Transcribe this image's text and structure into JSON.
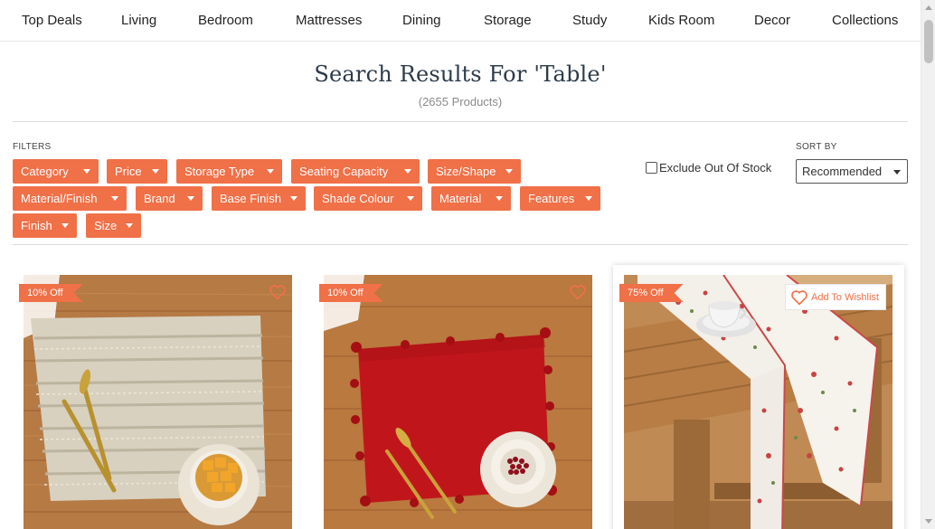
{
  "nav": {
    "items": [
      {
        "label": "Top Deals"
      },
      {
        "label": "Living"
      },
      {
        "label": "Bedroom"
      },
      {
        "label": "Mattresses"
      },
      {
        "label": "Dining"
      },
      {
        "label": "Storage"
      },
      {
        "label": "Study"
      },
      {
        "label": "Kids Room"
      },
      {
        "label": "Decor"
      },
      {
        "label": "Collections"
      }
    ]
  },
  "search": {
    "title": "Search Results For 'Table'",
    "count": "(2655 Products)"
  },
  "filters": {
    "label": "FILTERS",
    "chips": [
      {
        "label": "Category"
      },
      {
        "label": "Price"
      },
      {
        "label": "Storage Type"
      },
      {
        "label": "Seating Capacity"
      },
      {
        "label": "Size/Shape"
      },
      {
        "label": "Material/Finish"
      },
      {
        "label": "Brand"
      },
      {
        "label": "Base Finish"
      },
      {
        "label": "Shade Colour"
      },
      {
        "label": "Material"
      },
      {
        "label": "Features"
      },
      {
        "label": "Finish"
      },
      {
        "label": "Size"
      }
    ],
    "exclude_out_of_stock": {
      "label": "Exclude Out Of Stock",
      "checked": false
    }
  },
  "sort": {
    "label": "SORT BY",
    "selected": "Recommended"
  },
  "products": [
    {
      "discount": "10% Off",
      "wishlist_label": "",
      "image": "woven beige placemat with gold cutlery and bowl of mango"
    },
    {
      "discount": "10% Off",
      "wishlist_label": "",
      "image": "red placemat with pom-poms, gold cutlery and bowl of berries"
    },
    {
      "discount": "75% Off",
      "wishlist_label": "Add To Wishlist",
      "image": "floral table runner on rustic wooden table with cup and saucer"
    }
  ],
  "colors": {
    "accent": "#f07048",
    "title": "#2d3b4a",
    "wood": "#b9793f",
    "red_mat": "#c0161b"
  },
  "icons": {
    "heart": "heart-icon",
    "caret": "caret-down-icon"
  }
}
